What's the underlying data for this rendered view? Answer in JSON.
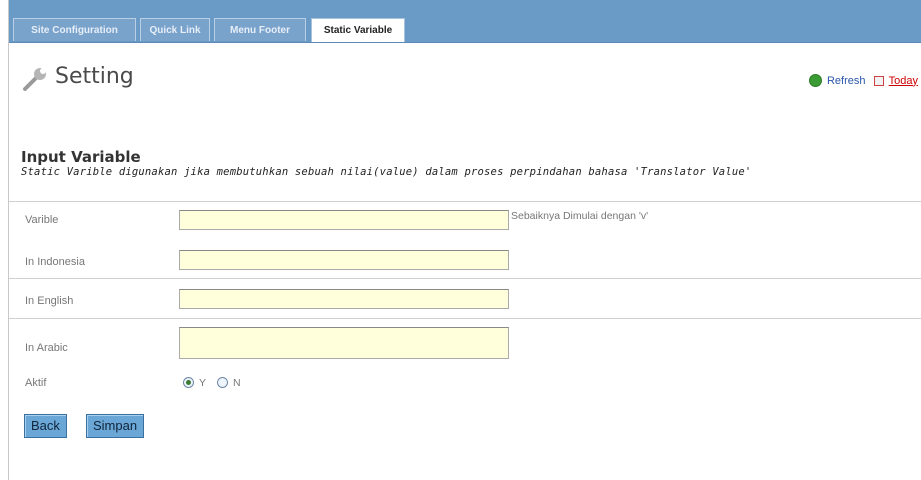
{
  "tabs": [
    {
      "label": "Site Configuration",
      "active": false
    },
    {
      "label": "Quick Link",
      "active": false
    },
    {
      "label": "Menu Footer",
      "active": false
    },
    {
      "label": "Static Variable",
      "active": true
    }
  ],
  "header": {
    "title": "Setting",
    "refresh_label": "Refresh",
    "today_label": "Today"
  },
  "form": {
    "section_title": "Input Variable",
    "description": "Static Varible digunakan jika membutuhkan sebuah nilai(value) dalam proses perpindahan bahasa 'Translator Value'",
    "fields": {
      "variable": {
        "label": "Varible",
        "value": "",
        "hint": "Sebaiknya Dimulai dengan 'v'"
      },
      "in_indonesia": {
        "label": "In Indonesia",
        "value": ""
      },
      "in_english": {
        "label": "In English",
        "value": ""
      },
      "in_arabic": {
        "label": "In Arabic",
        "value": ""
      }
    },
    "aktif": {
      "label": "Aktif",
      "options": [
        {
          "label": "Y",
          "checked": true
        },
        {
          "label": "N",
          "checked": false
        }
      ]
    },
    "buttons": {
      "back": "Back",
      "save": "Simpan"
    }
  },
  "colors": {
    "tabbar": "#6a9ac6",
    "input_bg": "#ffffdc",
    "button_bg": "#6aa7d6",
    "today_link": "#cc0000"
  }
}
